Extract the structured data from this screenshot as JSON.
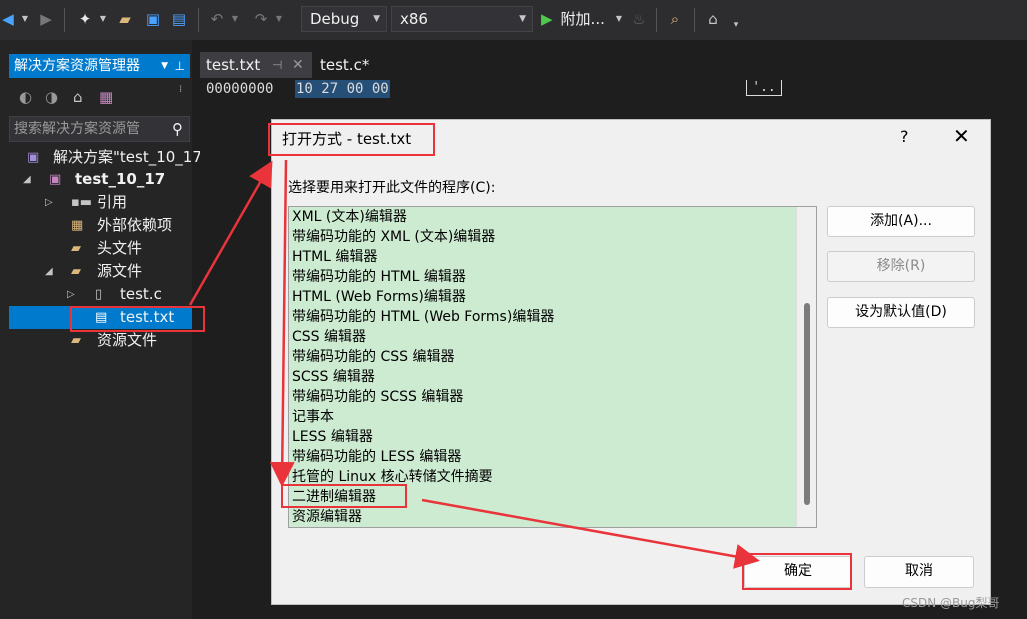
{
  "toolbar": {
    "configuration": "Debug",
    "platform": "x86",
    "run_label": "附加...",
    "icons": [
      "back-icon",
      "forward-icon",
      "new-project-icon",
      "open-folder-icon",
      "save-icon",
      "save-all-icon",
      "undo-icon",
      "redo-icon",
      "play-icon",
      "flame-icon",
      "find-in-files-icon",
      "home-icon"
    ]
  },
  "solution_explorer": {
    "title": "解决方案资源管理器",
    "search_placeholder": "搜索解决方案资源管",
    "tree": [
      {
        "label": "解决方案\"test_10_17",
        "icon": "solution-icon"
      },
      {
        "label": "test_10_17",
        "icon": "project-icon"
      },
      {
        "label": "引用",
        "icon": "references-icon"
      },
      {
        "label": "外部依赖项",
        "icon": "external-deps-icon"
      },
      {
        "label": "头文件",
        "icon": "folder-icon"
      },
      {
        "label": "源文件",
        "icon": "folder-icon"
      },
      {
        "label": "test.c",
        "icon": "c-file-icon"
      },
      {
        "label": "test.txt",
        "icon": "text-file-icon"
      },
      {
        "label": "资源文件",
        "icon": "folder-icon"
      }
    ]
  },
  "editor": {
    "tabs": [
      {
        "label": "test.txt"
      },
      {
        "label": "test.c*"
      }
    ],
    "hex_offset": "00000000",
    "hex_bytes": "10 27 00 00",
    "hex_ascii": "'.."
  },
  "dialog": {
    "title": "打开方式 - test.txt",
    "help": "?",
    "close": "✕",
    "prompt": "选择要用来打开此文件的程序(C):",
    "programs": [
      "XML (文本)编辑器",
      "带编码功能的 XML (文本)编辑器",
      "HTML 编辑器",
      "带编码功能的 HTML 编辑器",
      "HTML (Web Forms)编辑器",
      "带编码功能的 HTML (Web Forms)编辑器",
      "CSS 编辑器",
      "带编码功能的 CSS 编辑器",
      "SCSS 编辑器",
      "带编码功能的 SCSS 编辑器",
      "记事本",
      "LESS 编辑器",
      "带编码功能的 LESS 编辑器",
      "托管的 Linux 核心转储文件摘要",
      "二进制编辑器",
      "资源编辑器"
    ],
    "buttons": {
      "add": "添加(A)...",
      "remove": "移除(R)",
      "set_default": "设为默认值(D)",
      "ok": "确定",
      "cancel": "取消"
    }
  },
  "watermark": "CSDN @Bug梨哥",
  "colors": {
    "accent": "#007acc",
    "highlight": "#e8343a",
    "list_bg": "#cdebd1"
  }
}
